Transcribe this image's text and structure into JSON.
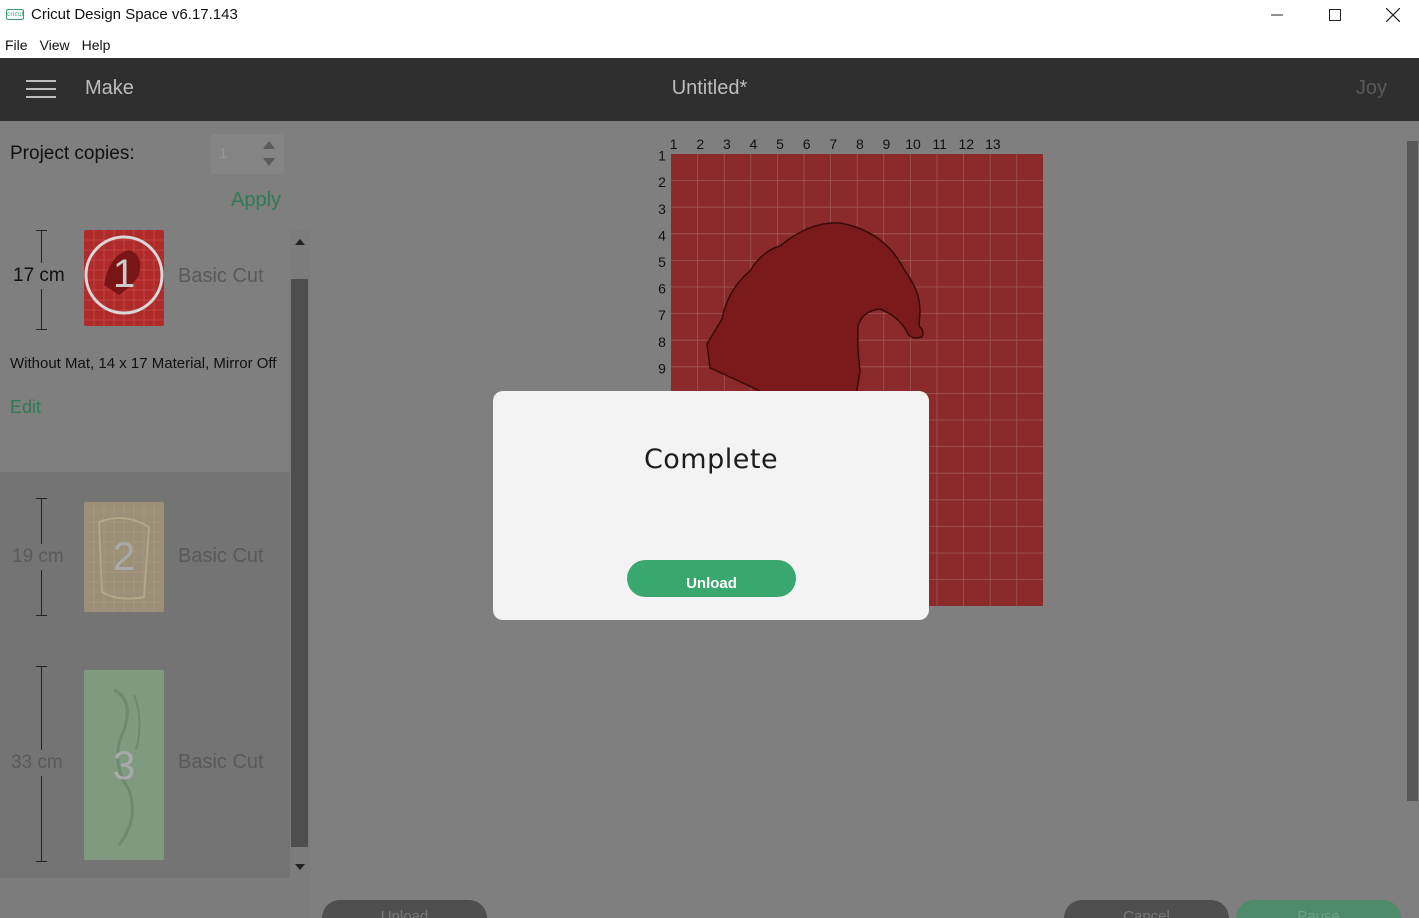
{
  "window": {
    "app_logo_text": "cricut",
    "title": "Cricut Design Space  v6.17.143"
  },
  "menu": {
    "items": [
      "File",
      "View",
      "Help"
    ]
  },
  "header": {
    "mode": "Make",
    "project_title": "Untitled*",
    "machine": "Joy"
  },
  "copies": {
    "label": "Project copies:",
    "value": "1",
    "apply_label": "Apply"
  },
  "mats": [
    {
      "number": "1",
      "length": "17 cm",
      "type": "Basic Cut",
      "description": "Without Mat, 14 x 17 Material, Mirror Off",
      "edit_label": "Edit",
      "color": "#a0262a"
    },
    {
      "number": "2",
      "length": "19 cm",
      "type": "Basic Cut",
      "color": "#d2b98a"
    },
    {
      "number": "3",
      "length": "33 cm",
      "type": "Basic Cut",
      "color": "#90b890"
    }
  ],
  "mat_preview": {
    "col_labels": [
      "1",
      "2",
      "3",
      "4",
      "5",
      "6",
      "7",
      "8",
      "9",
      "10",
      "11",
      "12",
      "13"
    ],
    "row_labels": [
      "1",
      "2",
      "3",
      "4",
      "5",
      "6",
      "7",
      "8",
      "9"
    ],
    "mat_color": "#8a2a2a",
    "shape_color": "#7a1a1a"
  },
  "dialog": {
    "title": "Complete",
    "button_label": "Unload"
  },
  "bottom_bar": {
    "unload_label": "Unload",
    "cancel_label": "Cancel",
    "pause_label": "Pause"
  }
}
